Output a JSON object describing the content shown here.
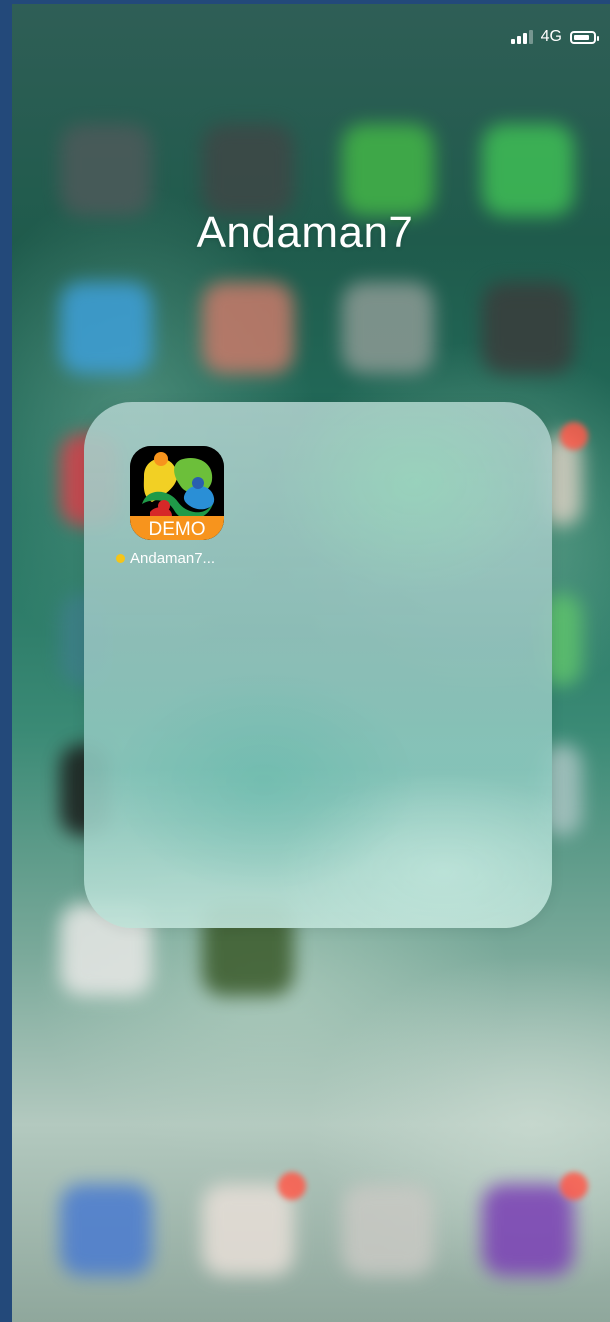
{
  "status_bar": {
    "network": "4G",
    "battery_level": 0.75
  },
  "folder": {
    "title": "Andaman7",
    "apps": [
      {
        "label": "Andaman7...",
        "icon_name": "andaman7-demo-app-icon",
        "icon_text": "DEMO",
        "new_indicator_color": "#f5c518"
      }
    ]
  },
  "colors": {
    "frame": "#23497a",
    "demo_banner": "#f7941d",
    "badge": "#ff5a4a"
  }
}
